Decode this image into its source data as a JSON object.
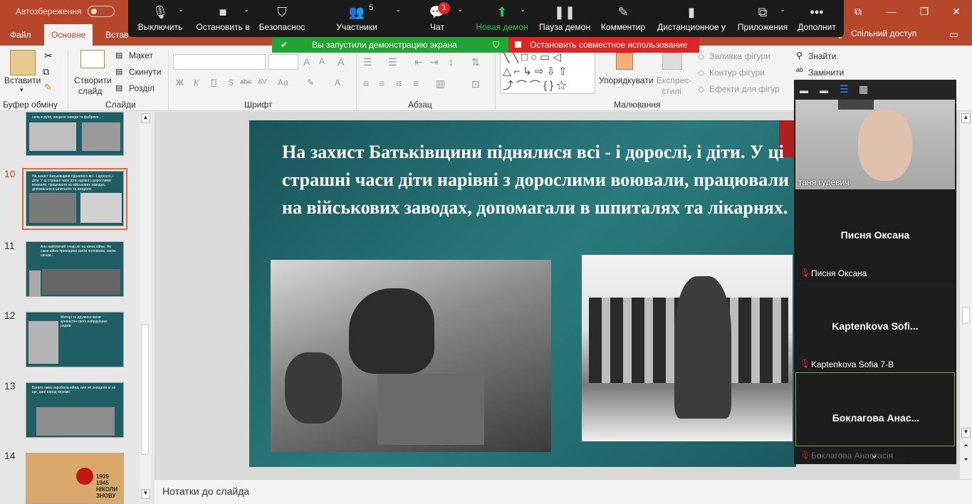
{
  "titlebar": {
    "autosave": "Автозбереження",
    "win_ribbon_icon": "⧉",
    "win_min": "—",
    "win_max": "❐",
    "win_close": "✕"
  },
  "tabs": {
    "file": "Файл",
    "home": "Основне",
    "insert": "Встав",
    "share": "Спільний доступ"
  },
  "zoom_toolbar": {
    "mute": "Выключить",
    "video": "Остановить в",
    "security": "Безопаснос",
    "participants": "Участники",
    "participants_count": "5",
    "chat": "Чат",
    "chat_badge": "1",
    "new_share": "Новая демон",
    "pause_share": "Пауза демон",
    "annotate": "Комментир",
    "remote_control": "Дистанционное у",
    "apps": "Приложения",
    "more": "Дополнит"
  },
  "share_banner": {
    "started": "Вы запустили демонстрацию экрана",
    "stop": "Остановить совместное использование"
  },
  "ribbon": {
    "paste": "Вставити",
    "new_slide_1": "Створити",
    "new_slide_2": "слайд",
    "layout": "Макет",
    "reset": "Скинути",
    "section": "Розділ",
    "clipboard_group": "Буфер обміну",
    "slides_group": "Слайди",
    "font_group": "Шрифт",
    "paragraph_group": "Абзац",
    "drawing_group": "Малювання",
    "bold": "Ж",
    "italic": "К",
    "underline": "П",
    "strike": "abc",
    "spacing": "AV",
    "case": "Aa",
    "arrange": "Упорядкувати",
    "quick_styles_1": "Експрес-",
    "quick_styles_2": "стилі",
    "shape_fill": "Заливка фігури",
    "shape_outline": "Контур фігури",
    "shape_effects": "Ефекти для фігур",
    "find": "Знайти",
    "replace": "Замінити"
  },
  "thumbnails": [
    {
      "num": "",
      "text": "села в руїні, нищили заводи та фабрики..."
    },
    {
      "num": "10",
      "text": "На захист Батьківщини піднялися всі - і дорослі, і діти. У ці страшні часи діти нарівні з дорослими воювали, працювали на військових заводах, допомагали в шпиталях та лікарнях."
    },
    {
      "num": "11",
      "text": "Але найтяжчий тягар ліг на жінок війни. Як саме війна приходила своїм чоловікам, своїм синам..."
    },
    {
      "num": "12",
      "text": "Матері та дружини жили кревністю своїх найрідніших рядків:"
    },
    {
      "num": "13",
      "text": "Багато лиха наробила війна, але не знищила ні не ще, дані народ переміг."
    },
    {
      "num": "14",
      "text": "1939 1945 НІКОЛИ ЗНОВУ"
    }
  ],
  "slide": {
    "title": "На захист Батьківщини піднялися всі - і дорослі, і діти. У ці страшні часи діти нарівні з дорослими воювали, працювали на військових заводах, допомагали в шпиталях та лікарнях."
  },
  "notes": "Нотатки до слайда",
  "zoom_panel": {
    "participants": [
      {
        "name": "таня гудевич",
        "has_video": true
      },
      {
        "name": "Писня Оксана",
        "label": "Писня Оксана",
        "muted": true
      },
      {
        "name": "Kaptenkova  Sofi...",
        "label": "Kaptenkova Sofia 7-В",
        "muted": true
      },
      {
        "name": "Боклагова  Анас...",
        "label": "Боклагова Анастасія",
        "muted": true
      }
    ]
  },
  "colors": {
    "accent": "#b7472a",
    "zoom_green": "#23a536",
    "zoom_red": "#e02424",
    "slide_bg": "#1f6a6d"
  }
}
